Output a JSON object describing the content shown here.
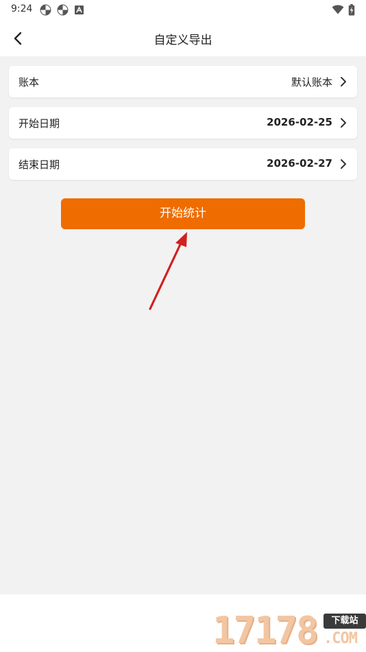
{
  "status_bar": {
    "time": "9:24",
    "left_icons": [
      "pinwheel-icon",
      "pinwheel-icon",
      "font-a-icon"
    ],
    "right_icons": [
      "wifi-icon",
      "battery-charging-icon"
    ]
  },
  "header": {
    "back_icon": "chevron-left-icon",
    "title": "自定义导出"
  },
  "rows": [
    {
      "label": "账本",
      "value": "默认账本"
    },
    {
      "label": "开始日期",
      "value": "2026-02-25"
    },
    {
      "label": "结束日期",
      "value": "2026-02-27"
    }
  ],
  "action_button": {
    "label": "开始统计",
    "color": "#ef6c00"
  },
  "annotation": {
    "icon": "red-arrow-pointer",
    "color": "#d32020"
  },
  "watermark": {
    "digits": "17178",
    "badge": "下载站",
    "domain": ".COM"
  },
  "colors": {
    "background": "#f2f2f2",
    "card": "#ffffff",
    "accent": "#ef6c00"
  }
}
